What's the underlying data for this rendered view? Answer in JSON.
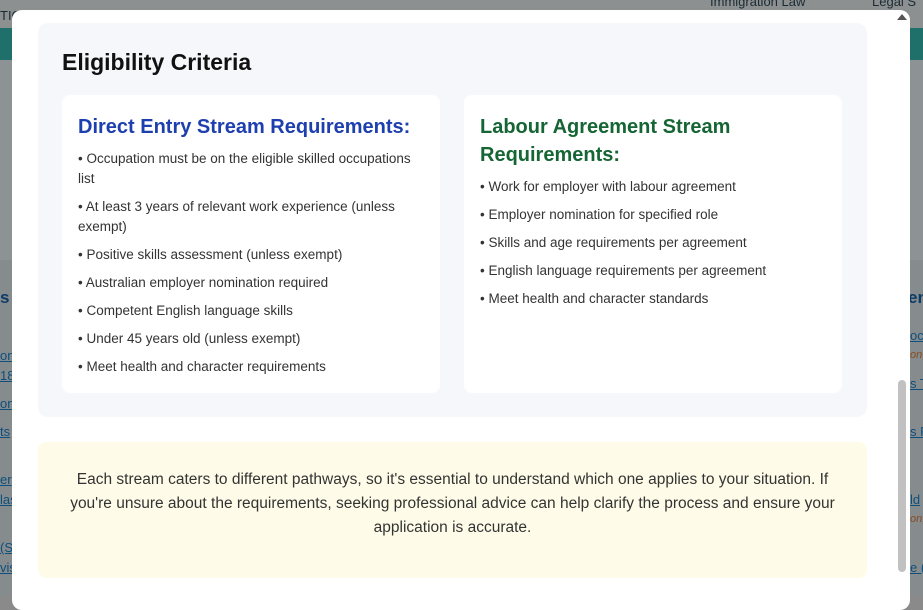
{
  "background": {
    "top_left_text": "TIC",
    "top_center_text": "Immigration Law",
    "top_right_text": "Legal S",
    "left_heading": "s",
    "right_heading": "en",
    "left_links": [
      "on",
      "18",
      "on",
      "ts",
      "er",
      "las",
      "(S",
      "vis"
    ],
    "right_links": [
      "oc",
      "s T",
      "s R",
      "ld",
      "e ("
    ],
    "right_orange": [
      "on,",
      "on,"
    ]
  },
  "modal": {
    "eligibility": {
      "title": "Eligibility Criteria",
      "direct_entry": {
        "title": "Direct Entry Stream Requirements:",
        "items": [
          "• Occupation must be on the eligible skilled occupations list",
          "• At least 3 years of relevant work experience (unless exempt)",
          "• Positive skills assessment (unless exempt)",
          "• Australian employer nomination required",
          "• Competent English language skills",
          "• Under 45 years old (unless exempt)",
          "• Meet health and character requirements"
        ]
      },
      "labour_agreement": {
        "title": "Labour Agreement Stream Requirements:",
        "items": [
          "• Work for employer with labour agreement",
          "• Employer nomination for specified role",
          "• Skills and age requirements per agreement",
          "• English language requirements per agreement",
          "• Meet health and character standards"
        ]
      }
    },
    "note": "Each stream caters to different pathways, so it's essential to understand which one applies to your situation. If you're unsure about the requirements, seeking professional advice can help clarify the process and ensure your application is accurate."
  },
  "colors": {
    "direct_title": "#1e40af",
    "labour_title": "#166534",
    "note_bg": "#fefce8",
    "panel_bg": "#f5f7fa"
  }
}
